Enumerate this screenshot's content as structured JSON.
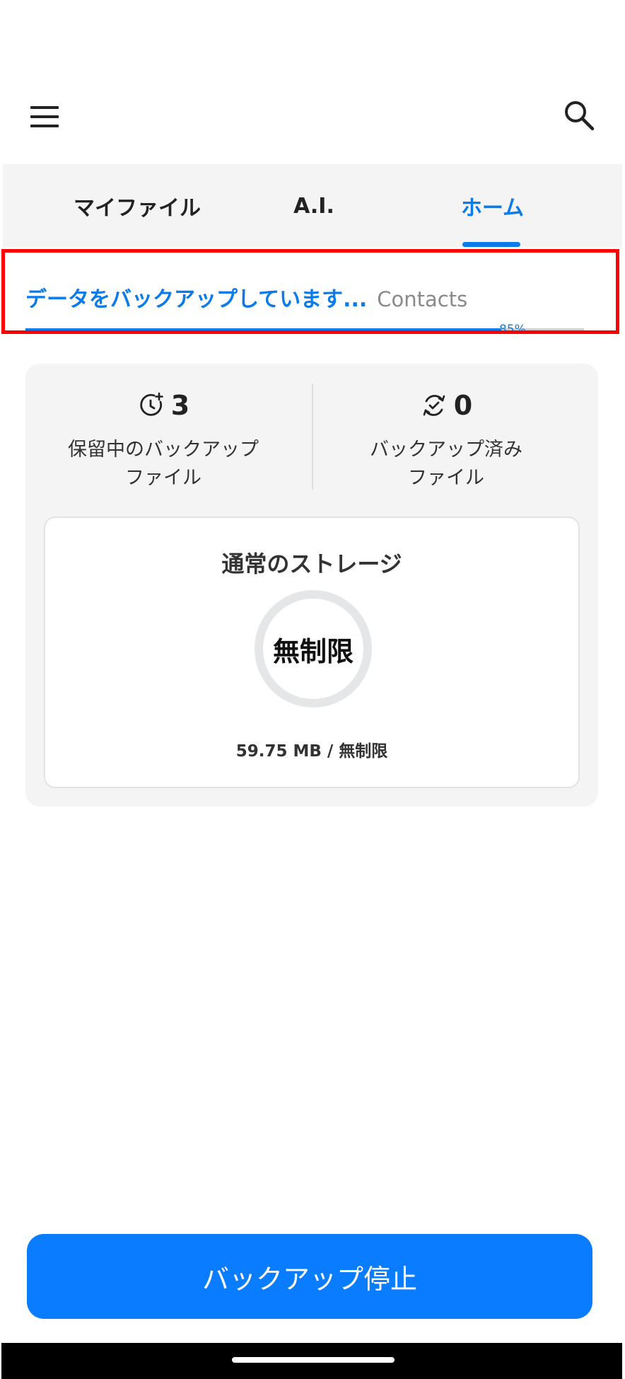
{
  "tabs": {
    "my_files": "マイファイル",
    "ai": "A.I.",
    "home": "ホーム",
    "active": "home"
  },
  "backup": {
    "status_text": "データをバックアップしています...",
    "current_item": "Contacts",
    "progress_label": "85%",
    "progress_fraction": 0.85
  },
  "stats": {
    "pending": {
      "count": "3",
      "label": "保留中のバックアップ\nファイル",
      "icon": "pending-clock-icon"
    },
    "done": {
      "count": "0",
      "label": "バックアップ済み\nファイル",
      "icon": "backup-sync-icon"
    }
  },
  "storage": {
    "title": "通常のストレージ",
    "ring_label": "無制限",
    "usage": "59.75 MB / 無制限"
  },
  "actions": {
    "stop_label": "バックアップ停止"
  },
  "colors": {
    "accent": "#0b7bea",
    "button": "#0a7cff",
    "highlight": "#ff0000"
  }
}
